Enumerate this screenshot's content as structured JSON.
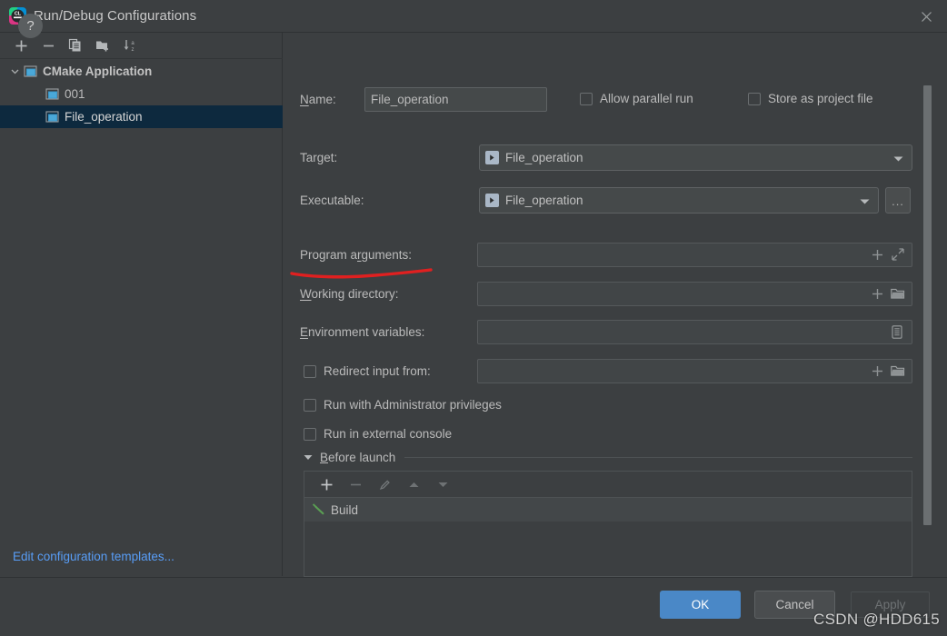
{
  "window": {
    "title": "Run/Debug Configurations",
    "app_icon": "clion-icon",
    "close_icon": "close-icon"
  },
  "sidebar": {
    "toolbar": [
      {
        "name": "add-configuration-button",
        "icon": "plus-icon"
      },
      {
        "name": "remove-configuration-button",
        "icon": "minus-icon"
      },
      {
        "name": "copy-configuration-button",
        "icon": "copy-icon"
      },
      {
        "name": "move-into-folder-button",
        "icon": "new-folder-icon"
      },
      {
        "name": "sort-configurations-button",
        "icon": "sort-az-icon"
      }
    ],
    "tree": [
      {
        "label": "CMake Application",
        "level": 0,
        "expanded": true,
        "selected": false,
        "icon": "application-icon"
      },
      {
        "label": "001",
        "level": 1,
        "expanded": false,
        "selected": false,
        "icon": "application-icon"
      },
      {
        "label": "File_operation",
        "level": 1,
        "expanded": false,
        "selected": true,
        "icon": "application-icon"
      }
    ],
    "edit_templates_link": "Edit configuration templates..."
  },
  "form": {
    "name_label": "Name:",
    "name_label_mnemonic": "N",
    "name_value": "File_operation",
    "allow_parallel_run": {
      "label": "Allow parallel run",
      "checked": false,
      "mnemonic": "n"
    },
    "store_as_project_file": {
      "label": "Store as project file",
      "checked": false,
      "mnemonic": "S",
      "gear_icon": "gear-icon"
    },
    "target_label": "Target:",
    "target_value": "File_operation",
    "executable_label": "Executable:",
    "executable_value": "File_operation",
    "executable_browse": "...",
    "program_arguments_label": "Program arguments:",
    "program_arguments_value": "",
    "working_directory_label": "Working directory:",
    "working_directory_value": "",
    "environment_variables_label": "Environment variables:",
    "environment_variables_value": "",
    "redirect_input_from": {
      "label": "Redirect input from:",
      "checked": false,
      "value": ""
    },
    "run_with_admin": {
      "label": "Run with Administrator privileges",
      "checked": false
    },
    "run_in_external_console": {
      "label": "Run in external console",
      "checked": false
    }
  },
  "before_launch": {
    "title": "Before launch",
    "expanded": true,
    "toolbar": [
      {
        "name": "add-task-button",
        "icon": "plus-icon",
        "enabled": true
      },
      {
        "name": "remove-task-button",
        "icon": "minus-icon",
        "enabled": false
      },
      {
        "name": "edit-task-button",
        "icon": "pencil-icon",
        "enabled": false
      },
      {
        "name": "move-task-up-button",
        "icon": "arrow-up-icon",
        "enabled": false
      },
      {
        "name": "move-task-down-button",
        "icon": "arrow-down-icon",
        "enabled": false
      }
    ],
    "tasks": [
      {
        "label": "Build",
        "icon": "hammer-icon"
      }
    ]
  },
  "footer": {
    "help_label": "?",
    "ok_label": "OK",
    "cancel_label": "Cancel",
    "apply_label": "Apply",
    "apply_enabled": false
  },
  "annotation": {
    "type": "red-underline",
    "under": "Working directory:",
    "color": "#e02020"
  },
  "watermark": "CSDN @HDD615",
  "colors": {
    "background": "#3c3f41",
    "selection": "#0d293e",
    "accent_button": "#4a88c7",
    "link": "#589df6",
    "annotation_red": "#e02020",
    "icon_teal": "#3592c4",
    "hammer_green": "#5a9e53"
  }
}
